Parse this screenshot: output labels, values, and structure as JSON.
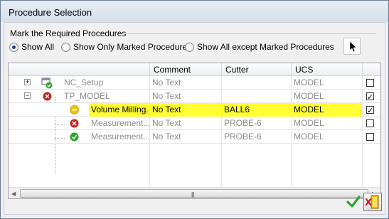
{
  "window": {
    "title": "Procedure Selection"
  },
  "group": {
    "label": "Mark the Required Procedures"
  },
  "radios": [
    {
      "label": "Show All",
      "selected": true
    },
    {
      "label": "Show Only Marked Procedures",
      "selected": false
    },
    {
      "label": "Show All except Marked Procedures",
      "selected": false
    }
  ],
  "columns": [
    "Comment",
    "Cutter",
    "UCS"
  ],
  "rows": [
    {
      "name": "NC_Setup",
      "comment": "No Text",
      "cutter": "",
      "ucs": "MODEL",
      "checked": false,
      "icon": "setup-ok-icon",
      "expander": "+"
    },
    {
      "name": "TP_MODEL",
      "comment": "No Text",
      "cutter": "",
      "ucs": "MODEL",
      "checked": true,
      "icon": "error-icon",
      "expander": "−"
    },
    {
      "name": "Volume Milling...",
      "comment": "No Text",
      "cutter": "BALL6",
      "ucs": "MODEL",
      "checked": true,
      "icon": "warning-icon"
    },
    {
      "name": "Measurement...",
      "comment": "No Text",
      "cutter": "PROBE-6",
      "ucs": "MODEL",
      "checked": false,
      "icon": "error-icon"
    },
    {
      "name": "Measurement...",
      "comment": "No Text",
      "cutter": "PROBE-6",
      "ucs": "MODEL",
      "checked": false,
      "icon": "success-icon"
    }
  ],
  "colors": {
    "highlight": "#ffff33",
    "error": "#c62020",
    "success": "#2aa52a",
    "warning": "#f2c200"
  }
}
